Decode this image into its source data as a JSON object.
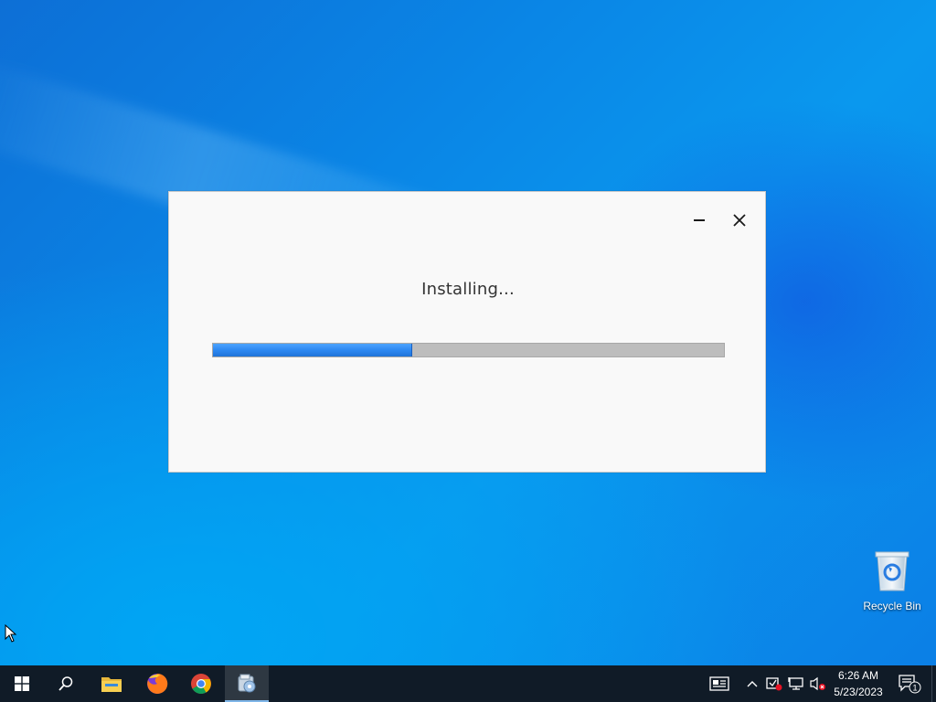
{
  "installer": {
    "status_text": "Installing...",
    "progress_percent": 39,
    "minimize_label": "Minimize",
    "close_label": "Close"
  },
  "desktop": {
    "icons": [
      {
        "label": "Recycle Bin",
        "icon": "recycle-bin-icon"
      }
    ]
  },
  "taskbar": {
    "apps": [
      {
        "name": "start",
        "icon": "windows-logo-icon"
      },
      {
        "name": "search",
        "icon": "search-icon"
      },
      {
        "name": "file-explorer",
        "icon": "folder-icon"
      },
      {
        "name": "firefox",
        "icon": "firefox-icon"
      },
      {
        "name": "chrome",
        "icon": "chrome-icon"
      },
      {
        "name": "installer",
        "icon": "installer-icon",
        "active": true
      }
    ],
    "tray": [
      "news-icon",
      "chevron-up-icon",
      "security-warning-icon",
      "network-icon",
      "volume-muted-icon"
    ],
    "clock": {
      "time": "6:26 AM",
      "date": "5/23/2023"
    },
    "notification_count": "1"
  },
  "colors": {
    "accent": "#2b86f0",
    "taskbar": "#101b27",
    "desktop": "#0a86e6"
  }
}
